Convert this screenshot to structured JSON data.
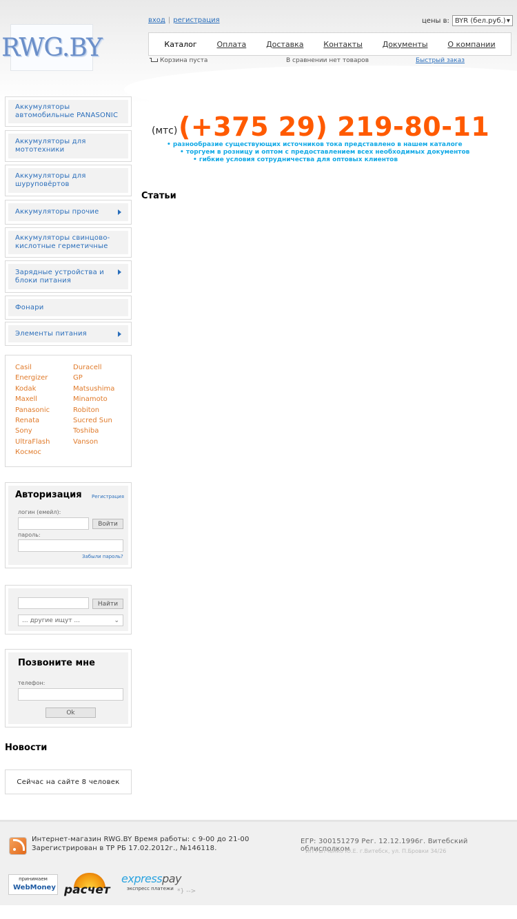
{
  "header": {
    "logo_text": "RWG.BY",
    "login": "вход",
    "register": "регистрация",
    "currency_label": "цены в:",
    "currency_value": "BYR (бел.руб.)",
    "nav": [
      "Каталог",
      "Оплата",
      "Доставка",
      "Контакты",
      "Документы",
      "О компании"
    ],
    "cart_status": "Корзина пуста",
    "compare_status": "В сравнении нет товаров",
    "quick_order": "Быстрый заказ"
  },
  "banner": {
    "operator": "(мтс)",
    "phone": "(+375 29) 219-80-11",
    "lines": [
      "• разнообразие существующих источников тока представлено в нашем  каталоге",
      "• торгуем в розницу и оптом с предоставлением всех необходимых документов",
      "• гибкие условия сотрудничества для оптовых клиентов"
    ]
  },
  "page": {
    "title": "Статьи"
  },
  "categories": [
    {
      "label": "Аккумуляторы автомобильные PANASONIC",
      "has_sub": false
    },
    {
      "label": "Аккумуляторы для мототехники",
      "has_sub": false
    },
    {
      "label": "Аккумуляторы для шуруповёртов",
      "has_sub": false
    },
    {
      "label": "Аккумуляторы прочие",
      "has_sub": true
    },
    {
      "label": "Аккумуляторы свинцово-кислотные герметичные",
      "has_sub": false
    },
    {
      "label": "Зарядные устройства и блоки питания",
      "has_sub": true
    },
    {
      "label": "Фонари",
      "has_sub": false
    },
    {
      "label": "Элементы питания",
      "has_sub": true
    }
  ],
  "brands": [
    "Casil",
    "Duracell",
    "Energizer",
    "GP",
    "Kodak",
    "Matsushima",
    "Maxell",
    "Minamoto",
    "Panasonic",
    "Robiton",
    "Renata",
    "Sucred Sun",
    "Sony",
    "Toshiba",
    "UltraFlash",
    "Vanson",
    "Космос"
  ],
  "auth": {
    "title": "Авторизация",
    "register_link": "Регистрация",
    "login_label": "логин (емейл):",
    "login_button": "Войти",
    "password_label": "пароль:",
    "forgot_link": "Забыли пароль?"
  },
  "search": {
    "button": "Найти",
    "others_placeholder": "... другие ищут ..."
  },
  "callback": {
    "title": "Позвоните мне",
    "phone_label": "телефон:",
    "ok_button": "Ok"
  },
  "news": {
    "title": "Новости"
  },
  "online": {
    "text": "Сейчас на сайте 8 человек"
  },
  "footer": {
    "line1": "Интернет-магазин RWG.BY Время работы: с 9-00 до 21-00",
    "line2": "Зарегистрирован в ТР РБ 17.02.2012г., №146118.",
    "egr": "ЕГР: 300151279 Рег. 12.12.1996г. Витебский облисполком",
    "owner": "ИП Рытченко Ю.Е. г.Витебск, ул. П.Бровки 34/26",
    "webmoney_top": "принимаем",
    "webmoney_brand": "WebMoney",
    "raschet": "расчет",
    "express_a": "express",
    "express_b": "pay",
    "express_sub": "экспресс платежи",
    "code_fragment": "*} -->"
  },
  "colors": {
    "link": "#2a6ebb",
    "phone": "#ff5a00",
    "banner_text": "#12a9e6",
    "brand": "#e07a2a"
  }
}
